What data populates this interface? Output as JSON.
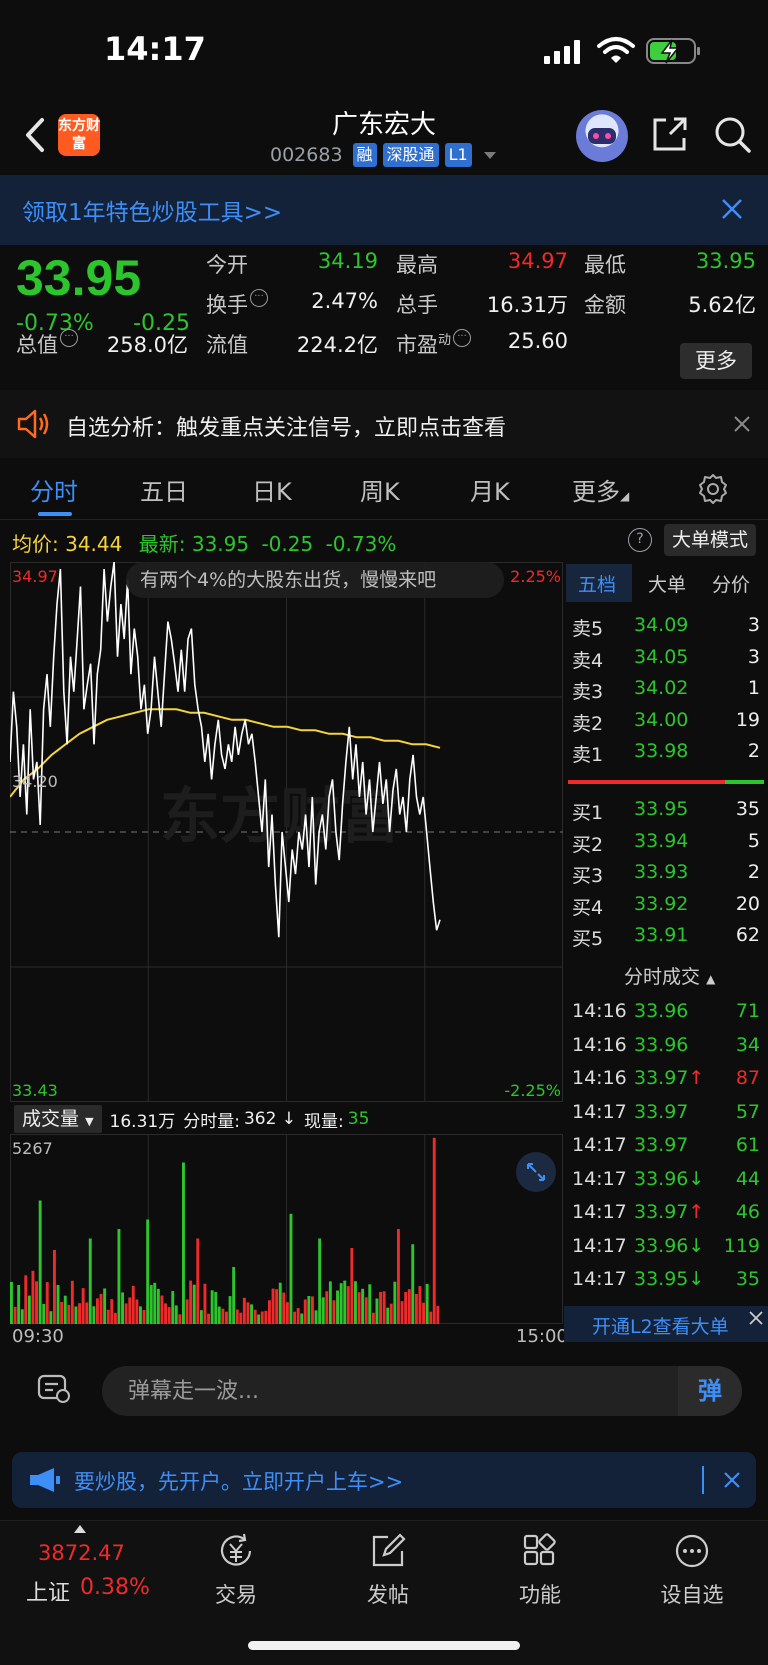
{
  "status_bar": {
    "time": "14:17"
  },
  "header": {
    "logo_text": "东方财富",
    "stock_name": "广东宏大",
    "stock_code": "002683",
    "tags": [
      "融",
      "深股通",
      "L1"
    ]
  },
  "promo": {
    "text": "领取1年特色炒股工具>>"
  },
  "quote": {
    "last_price": "33.95",
    "change_pct": "-0.73%",
    "change_val": "-0.25",
    "fields": [
      {
        "label": "今开",
        "value": "34.19",
        "color": "green"
      },
      {
        "label": "最高",
        "value": "34.97",
        "color": "red"
      },
      {
        "label": "最低",
        "value": "33.95",
        "color": "green"
      },
      {
        "label": "换手",
        "value": "2.47%",
        "color": "white"
      },
      {
        "label": "总手",
        "value": "16.31万",
        "color": "white"
      },
      {
        "label": "金额",
        "value": "5.62亿",
        "color": "white"
      },
      {
        "label": "总值",
        "value": "258.0亿",
        "color": "white"
      },
      {
        "label": "流值",
        "value": "224.2亿",
        "color": "white"
      },
      {
        "label": "市盈",
        "value": "25.60",
        "color": "white"
      }
    ],
    "pe_superscript": "动",
    "more_label": "更多"
  },
  "alert": {
    "text": "自选分析：触发重点关注信号，立即点击查看"
  },
  "tabs": [
    "分时",
    "五日",
    "日K",
    "周K",
    "月K",
    "更多"
  ],
  "avg_row": {
    "avg_label": "均价:",
    "avg_value": "34.44",
    "latest_label": "最新:",
    "latest_value": "33.95",
    "latest_change": "-0.25",
    "latest_pct": "-0.73%",
    "help": "?",
    "big_order_label": "大单模式"
  },
  "chart_data": {
    "type": "line",
    "ylim": [
      33.43,
      34.97
    ],
    "y_labels": {
      "top_left": "34.97",
      "mid_left": "34.20",
      "bottom_left": "33.43",
      "top_right": "2.25%",
      "bottom_right": "-2.25%"
    },
    "prev_close": 34.2,
    "watermark": "东方财富",
    "danmaku_bubble": "有两个4%的大股东出货，慢慢来吧",
    "series": [
      {
        "values": [
          34.4,
          34.6,
          34.5,
          34.3,
          34.45,
          34.25,
          34.55,
          34.35,
          34.4,
          34.22,
          34.55,
          34.65,
          34.5,
          34.7,
          34.85,
          34.95,
          34.6,
          34.45,
          34.7,
          34.6,
          34.75,
          34.9,
          34.55,
          34.62,
          34.68,
          34.45,
          34.65,
          34.72,
          34.95,
          34.8,
          34.9,
          34.97,
          34.7,
          34.85,
          34.75,
          34.92,
          34.65,
          34.78,
          34.7,
          34.55,
          34.62,
          34.48,
          34.55,
          34.7,
          34.6,
          34.5,
          34.65,
          34.8,
          34.75,
          34.68,
          34.6,
          34.72,
          34.6,
          34.75,
          34.78,
          34.62,
          34.55,
          34.5,
          34.4,
          34.48,
          34.35,
          34.45,
          34.52,
          34.42,
          34.38,
          34.45,
          34.4,
          34.5,
          34.42,
          34.48,
          34.52,
          34.45,
          34.48,
          34.4,
          34.3,
          34.2,
          34.35,
          34.1,
          34.25,
          34.05,
          33.9,
          34.2,
          34.1,
          34.0,
          34.15,
          34.08,
          34.2,
          34.15,
          34.25,
          34.1,
          34.3,
          34.05,
          34.2,
          34.25,
          34.15,
          34.3,
          34.35,
          34.2,
          34.12,
          34.28,
          34.4,
          34.5,
          34.35,
          34.45,
          34.3,
          34.4,
          34.25,
          34.35,
          34.2,
          34.3,
          34.4,
          34.28,
          34.35,
          34.2,
          34.32,
          34.38,
          34.25,
          34.3,
          34.2,
          34.35,
          34.42,
          34.3,
          34.25,
          34.3,
          34.2,
          34.1,
          34.0,
          33.92,
          33.95
        ]
      },
      {
        "values": [
          34.3,
          34.35,
          34.38,
          34.42,
          34.45,
          34.48,
          34.5,
          34.52,
          34.53,
          34.54,
          34.55,
          34.55,
          34.55,
          34.54,
          34.54,
          34.53,
          34.52,
          34.52,
          34.51,
          34.5,
          34.5,
          34.49,
          34.49,
          34.48,
          34.48,
          34.47,
          34.47,
          34.46,
          34.46,
          34.45,
          34.45,
          34.44
        ]
      }
    ]
  },
  "volume": {
    "selector": "成交量",
    "total": "16.31万",
    "minute_label": "分时量:",
    "minute_value": "362 ↓",
    "current_label": "现量:",
    "current_value": "35",
    "max_label": "5267",
    "time_start": "09:30",
    "time_end": "15:00"
  },
  "order_book": {
    "tabs": [
      "五档",
      "大单",
      "分价"
    ],
    "asks": [
      {
        "label": "卖5",
        "price": "34.09",
        "vol": "3"
      },
      {
        "label": "卖4",
        "price": "34.05",
        "vol": "3"
      },
      {
        "label": "卖3",
        "price": "34.02",
        "vol": "1"
      },
      {
        "label": "卖2",
        "price": "34.00",
        "vol": "19"
      },
      {
        "label": "卖1",
        "price": "33.98",
        "vol": "2"
      }
    ],
    "bids": [
      {
        "label": "买1",
        "price": "33.95",
        "vol": "35"
      },
      {
        "label": "买2",
        "price": "33.94",
        "vol": "5"
      },
      {
        "label": "买3",
        "price": "33.93",
        "vol": "2"
      },
      {
        "label": "买4",
        "price": "33.92",
        "vol": "20"
      },
      {
        "label": "买5",
        "price": "33.91",
        "vol": "62"
      }
    ],
    "ticks_title": "分时成交",
    "ticks": [
      {
        "time": "14:16",
        "price": "33.96",
        "vol": "71",
        "dir": "",
        "color": "green"
      },
      {
        "time": "14:16",
        "price": "33.96",
        "vol": "34",
        "dir": "",
        "color": "green"
      },
      {
        "time": "14:16",
        "price": "33.97",
        "vol": "87",
        "dir": "↑",
        "color": "red"
      },
      {
        "time": "14:17",
        "price": "33.97",
        "vol": "57",
        "dir": "",
        "color": "green"
      },
      {
        "time": "14:17",
        "price": "33.97",
        "vol": "61",
        "dir": "",
        "color": "green"
      },
      {
        "time": "14:17",
        "price": "33.96",
        "vol": "44",
        "dir": "↓",
        "color": "green"
      },
      {
        "time": "14:17",
        "price": "33.97",
        "vol": "46",
        "dir": "↑",
        "color": "green"
      },
      {
        "time": "14:17",
        "price": "33.96",
        "vol": "119",
        "dir": "↓",
        "color": "green"
      },
      {
        "time": "14:17",
        "price": "33.95",
        "vol": "35",
        "dir": "↓",
        "color": "green"
      }
    ],
    "l2_text": "开通L2查看大单"
  },
  "danmaku": {
    "placeholder": "弹幕走一波...",
    "send_label": "弹"
  },
  "account_banner": {
    "text": "要炒股，先开户。立即开户上车>>"
  },
  "bottom_nav": {
    "index_value": "3872.47",
    "index_name": "上证",
    "index_pct": "0.38%",
    "items": [
      "交易",
      "发帖",
      "功能",
      "设自选"
    ]
  },
  "colors": {
    "up": "#ee2a2a",
    "down": "#2dc52d",
    "avg_line": "#f5d33a",
    "accent": "#3e8ef7"
  }
}
